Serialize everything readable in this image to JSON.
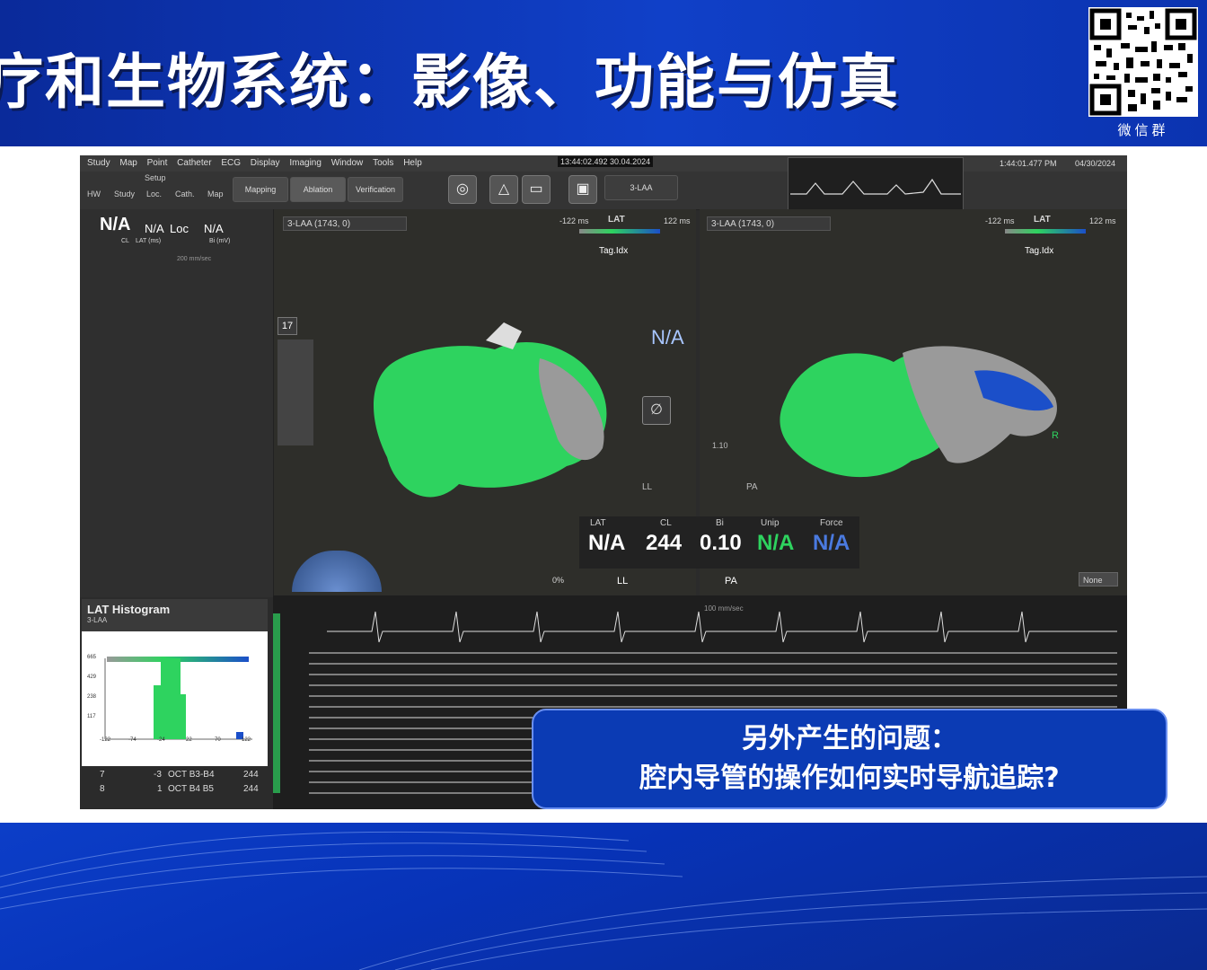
{
  "slide": {
    "title": "疗和生物系统：影像、功能与仿真",
    "qr_label": "微信群",
    "callout_line1": "另外产生的问题：",
    "callout_line2": "腔内导管的操作如何实时导航追踪?"
  },
  "app": {
    "menu": [
      "Study",
      "Map",
      "Point",
      "Catheter",
      "ECG",
      "Display",
      "Imaging",
      "Window",
      "Tools",
      "Help"
    ],
    "setup_label": "Setup",
    "sub_tabs": [
      "HW",
      "Study",
      "Loc.",
      "Cath.",
      "Map"
    ],
    "mode_tabs": [
      "Mapping",
      "Ablation",
      "Verification"
    ],
    "timestamp_center": "13:44:02.492  30.04.2024",
    "clock_time": "1:44:01.477 PM",
    "clock_date": "04/30/2024",
    "map_name_box": "3-LAA",
    "left_panel": {
      "cl_value": "N/A",
      "lat_value": "N/A",
      "loc_label": "Loc",
      "bi_value": "N/A",
      "cl_label": "CL",
      "lat_label": "LAT (ms)",
      "bi_label": "Bi (mV)",
      "speed": "200 mm/sec"
    },
    "left_view": {
      "map_select": "3-LAA (1743, 0)",
      "scale_min": "-122 ms",
      "scale_mid": "LAT",
      "scale_max": "122 ms",
      "tag_label": "Tag.Idx",
      "counter": "17",
      "na_badge": "N/A",
      "bottom_label": "LL",
      "pct": "0%"
    },
    "right_view": {
      "map_select": "3-LAA (1743, 0)",
      "scale_min": "-122 ms",
      "scale_mid": "LAT",
      "scale_max": "122 ms",
      "tag_label": "Tag.Idx",
      "bottom_label": "PA",
      "r_marker": "R",
      "none_select": "None"
    },
    "readout": {
      "lat_label": "LAT",
      "lat_value": "N/A",
      "cl_label": "CL",
      "cl_value": "244",
      "bi_label": "Bi",
      "bi_value": "0.10",
      "unip_label": "Unip",
      "unip_value": "N/A",
      "force_label": "Force",
      "force_value": "N/A",
      "slider_value": "1.10",
      "ll_label": "LL",
      "pa_label": "PA"
    },
    "histogram": {
      "title": "LAT Histogram",
      "subtitle": "3-LAA",
      "y_ticks": [
        "665",
        "429",
        "238",
        "117"
      ],
      "x_ticks": [
        "-122",
        "-74",
        "-24",
        "22",
        "70",
        "122"
      ]
    },
    "traces": {
      "speed": "100 mm/sec"
    },
    "table_rows": [
      {
        "idx": "7",
        "val": "-3",
        "name": "OCT B3-B4",
        "cl": "244"
      },
      {
        "idx": "8",
        "val": "1",
        "name": "OCT B4  B5",
        "cl": "244"
      }
    ]
  },
  "colors": {
    "header_blue": "#1040c8",
    "map_green": "#2ed35f",
    "map_blue": "#1b4fc9",
    "callout_blue": "#0b3bb4"
  }
}
